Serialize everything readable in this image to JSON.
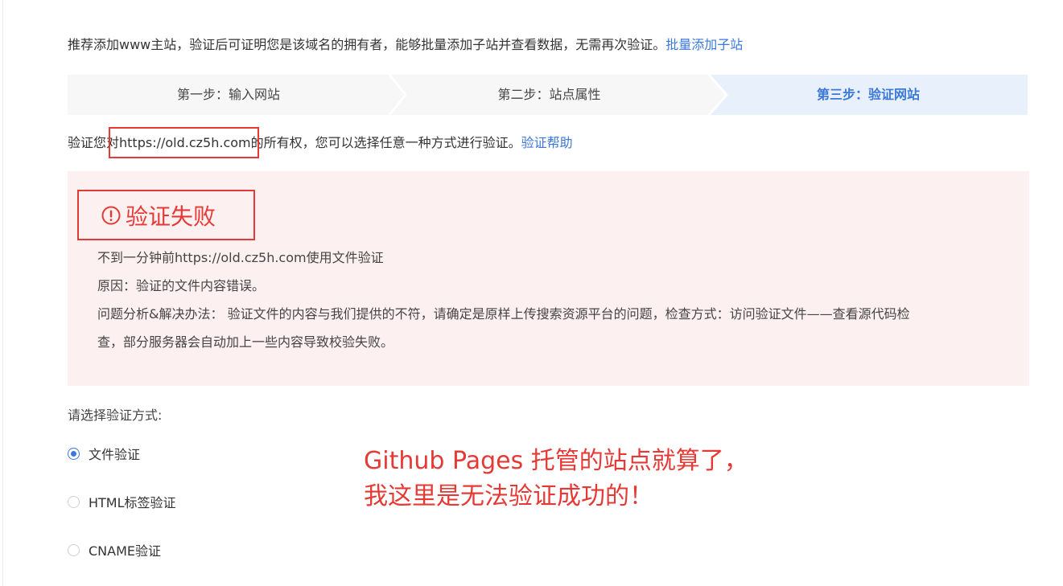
{
  "intro": {
    "text": "推荐添加www主站，验证后可证明您是该域名的拥有者，能够批量添加子站并查看数据，无需再次验证。",
    "link": "批量添加子站"
  },
  "steps": [
    {
      "label": "第一步：输入网站",
      "active": false
    },
    {
      "label": "第二步：站点属性",
      "active": false
    },
    {
      "label": "第三步：验证网站",
      "active": true
    }
  ],
  "verify": {
    "prefix": "验证您对",
    "domain": "https://old.cz5h.com",
    "suffix": "的所有权，您可以选择任意一种方式进行验证。",
    "help_link": "验证帮助"
  },
  "failure": {
    "title": "验证失败",
    "lines": [
      "不到一分钟前https://old.cz5h.com使用文件验证",
      "原因：验证的文件内容错误。",
      "问题分析&解决办法： 验证文件的内容与我们提供的不符，请确定是原样上传搜索资源平台的问题，检查方式：访问验证文件——查看源代码检",
      "查，部分服务器会自动加上一些内容导致校验失败。"
    ]
  },
  "methods": {
    "label": "请选择验证方式:",
    "options": [
      {
        "label": "文件验证",
        "checked": true
      },
      {
        "label": "HTML标签验证",
        "checked": false
      },
      {
        "label": "CNAME验证",
        "checked": false
      }
    ]
  },
  "annotation": {
    "line1": "Github Pages 托管的站点就算了，",
    "line2": "我这里是无法验证成功的！"
  },
  "colors": {
    "accent": "#3c78d8",
    "error": "#e53935",
    "error_bg": "#fdf0f0",
    "step_bg": "#f7f7f7",
    "step_active_bg": "#e8f0fc"
  }
}
